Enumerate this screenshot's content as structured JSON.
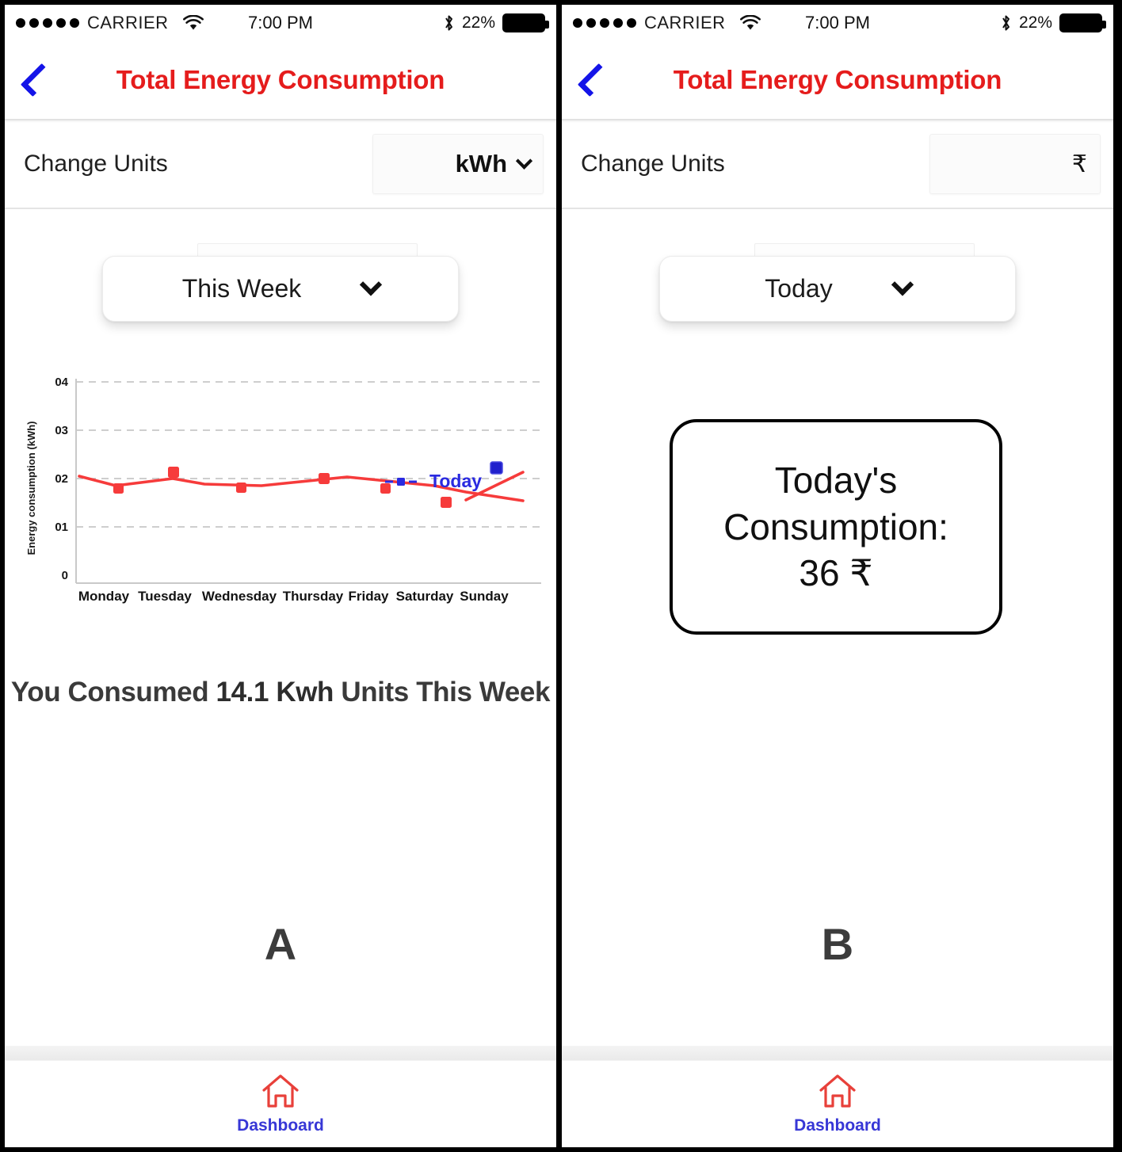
{
  "statusbar": {
    "carrier": "CARRIER",
    "time": "7:00 PM",
    "battery_percent": "22%",
    "signal_dots": 5,
    "wifi_icon": "wifi-icon",
    "bluetooth_icon": "bluetooth-icon",
    "battery_icon": "battery-icon"
  },
  "nav": {
    "back_icon": "chevron-left-icon",
    "title": "Total Energy Consumption",
    "title_color": "#e51c1c",
    "back_color": "#1414e8"
  },
  "units_row": {
    "label": "Change Units",
    "value_a": "kWh",
    "value_b": "₹",
    "chevron_icon": "chevron-down-icon"
  },
  "panel_a": {
    "letter": "A",
    "period": {
      "value": "This Week",
      "chevron_icon": "chevron-down-icon"
    },
    "summary_prefix": "You Consumed ",
    "summary_highlight": "14.1 Kwh",
    "summary_suffix": " Units This Week"
  },
  "panel_b": {
    "letter": "B",
    "period": {
      "value": "Today",
      "chevron_icon": "chevron-down-icon"
    },
    "card_line1": "Today's",
    "card_line2": "Consumption:",
    "card_line3": "36 ₹"
  },
  "tabbar": {
    "icon": "home-icon",
    "label": "Dashboard",
    "icon_color": "#e8403a",
    "label_color": "#3737d6"
  },
  "chart_data": {
    "type": "line",
    "title": "",
    "xlabel": "",
    "ylabel": "Energy consumption (kWh)",
    "categories": [
      "Monday",
      "Tuesday",
      "Wednesday",
      "Thursday",
      "Friday",
      "Saturday",
      "Sunday"
    ],
    "ytick_labels": [
      "0",
      "01",
      "02",
      "03",
      "04"
    ],
    "ytick_values": [
      0,
      1,
      2,
      3,
      4
    ],
    "ylim": [
      0,
      4
    ],
    "grid": true,
    "grid_style": "dashed",
    "grid_color": "#bcbcbc",
    "legend_position": "bottom-right",
    "series": [
      {
        "name": "Energy consumption",
        "color": "#f63b3b",
        "values": [
          2.05,
          1.85,
          2.13,
          1.85,
          2.03,
          1.85,
          1.55
        ]
      },
      {
        "name": "Today",
        "color": "#2020cc",
        "values": [
          null,
          null,
          null,
          null,
          null,
          null,
          2.27
        ]
      }
    ],
    "points": [
      {
        "x": "Monday",
        "y": 2.05,
        "color": "#f63b3b",
        "marker": "square"
      },
      {
        "x": "Tuesday",
        "y": 1.85,
        "color": "#f63b3b",
        "marker": "square"
      },
      {
        "x": "Wednesday",
        "y": 2.13,
        "color": "#f63b3b",
        "marker": "square"
      },
      {
        "x": "Thursday",
        "y": 1.85,
        "color": "#f63b3b",
        "marker": "square"
      },
      {
        "x": "Friday",
        "y": 2.03,
        "color": "#f63b3b",
        "marker": "square"
      },
      {
        "x": "Saturday",
        "y": 1.85,
        "color": "#f63b3b",
        "marker": "square"
      },
      {
        "x": "Sunday",
        "y": 1.55,
        "color": "#f63b3b",
        "marker": "square"
      },
      {
        "x": "Today",
        "y": 2.27,
        "color": "#2020cc",
        "marker": "square"
      }
    ],
    "legend": [
      {
        "label": "Today",
        "color": "#2a2ae0"
      }
    ],
    "total_label": "14.1 Kwh"
  }
}
